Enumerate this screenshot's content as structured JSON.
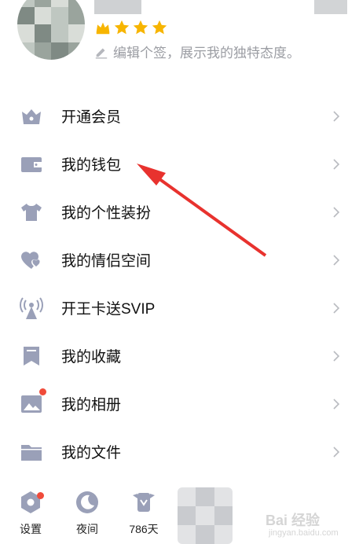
{
  "profile": {
    "signature": "编辑个签，展示我的独特态度。",
    "stars": [
      "crown-star",
      "star",
      "star",
      "star"
    ]
  },
  "menu": [
    {
      "label": "开通会员",
      "icon": "vip-crown-icon"
    },
    {
      "label": "我的钱包",
      "icon": "wallet-icon"
    },
    {
      "label": "我的个性装扮",
      "icon": "tshirt-icon"
    },
    {
      "label": "我的情侣空间",
      "icon": "hearts-icon"
    },
    {
      "label": "开王卡送SVIP",
      "icon": "signal-tower-icon"
    },
    {
      "label": "我的收藏",
      "icon": "bookmark-icon"
    },
    {
      "label": "我的相册",
      "icon": "album-icon"
    },
    {
      "label": "我的文件",
      "icon": "folder-icon"
    }
  ],
  "bottom_bar": [
    {
      "label": "设置",
      "icon": "settings-icon"
    },
    {
      "label": "夜间",
      "icon": "moon-icon"
    },
    {
      "label": "786天",
      "icon": "calendar-badge-icon"
    }
  ],
  "watermark": {
    "text": "Bai 经验",
    "sub": "jingyan.baidu.com"
  },
  "colors": {
    "icon": "#9aa0b8",
    "badge": "#f04b3a",
    "arrow": "#e8322e",
    "star": "#f7b500"
  }
}
